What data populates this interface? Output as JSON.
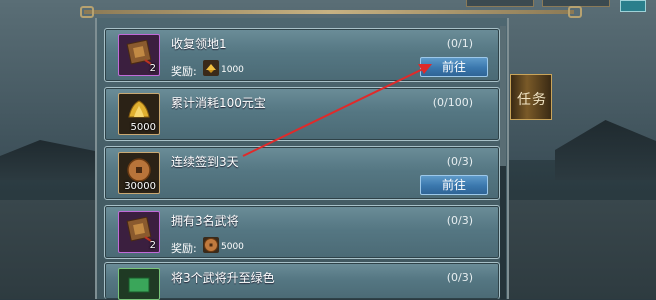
{
  "tasks": [
    {
      "title": "收复领地1",
      "progress": "(0/1)",
      "count": "2",
      "reward_label": "奖励:",
      "reward_amount": "1000",
      "button": "前往",
      "icon": "scroll-icon"
    },
    {
      "title": "累计消耗100元宝",
      "progress": "(0/100)",
      "count": "5000",
      "icon": "gold-ingot-icon"
    },
    {
      "title": "连续签到3天",
      "progress": "(0/3)",
      "count": "30000",
      "button": "前往",
      "icon": "coin-icon"
    },
    {
      "title": "拥有3名武将",
      "progress": "(0/3)",
      "count": "2",
      "reward_label": "奖励:",
      "reward_amount": "5000",
      "icon": "scroll-icon"
    },
    {
      "title": "将3个武将升至绿色",
      "progress": "(0/3)",
      "icon": "green-card-icon"
    }
  ],
  "side_tab": {
    "label": "任务"
  },
  "colors": {
    "arrow": "#e02a2a",
    "button": "#3a77ad",
    "row": "#557783"
  }
}
